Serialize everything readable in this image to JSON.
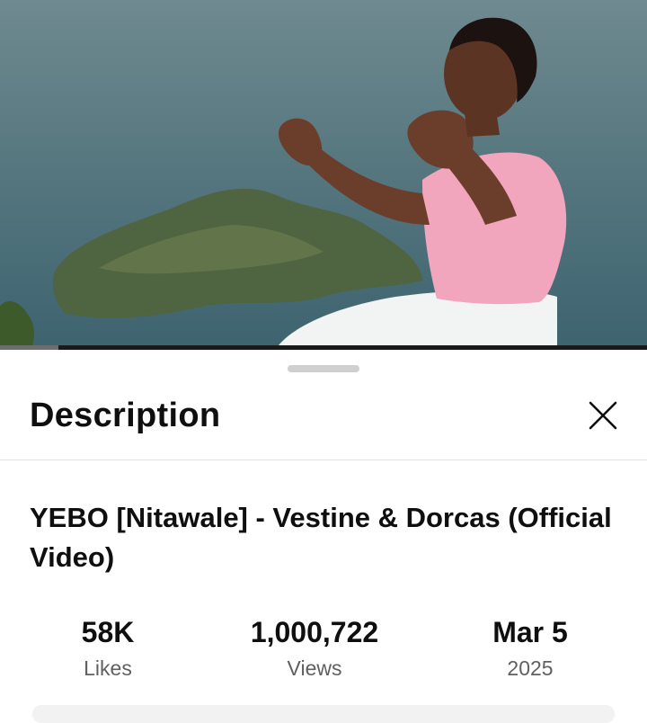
{
  "video": {
    "thumbnail_icon": "video-frame-image"
  },
  "progress": {
    "played_fraction": 0.0,
    "buffered_fraction": 0.09
  },
  "sheet": {
    "title": "Description",
    "close_icon": "close-icon"
  },
  "video_info": {
    "title": "YEBO [Nitawale] - Vestine & Dorcas (Official Video)"
  },
  "stats": [
    {
      "value": "58K",
      "label": "Likes"
    },
    {
      "value": "1,000,722",
      "label": "Views"
    },
    {
      "value": "Mar 5",
      "label": "2025"
    }
  ],
  "colors": {
    "accent": "#cc0000",
    "text_primary": "#0f0f0f",
    "text_secondary": "#606060"
  }
}
